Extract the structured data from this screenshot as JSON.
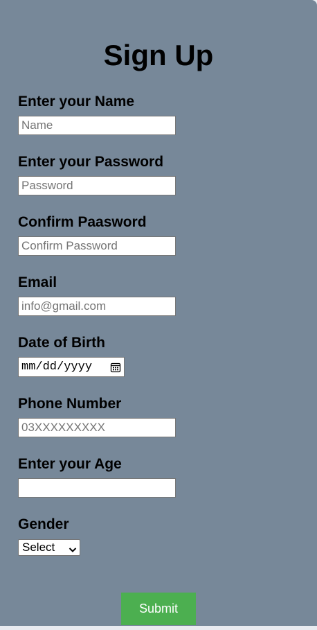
{
  "form": {
    "title": "Sign Up",
    "fields": {
      "name": {
        "label": "Enter your Name",
        "placeholder": "Name",
        "value": ""
      },
      "password": {
        "label": "Enter your Password",
        "placeholder": "Password",
        "value": ""
      },
      "confirm_password": {
        "label": "Confirm Paasword",
        "placeholder": "Confirm Password",
        "value": ""
      },
      "email": {
        "label": "Email",
        "placeholder": "info@gmail.com",
        "value": ""
      },
      "dob": {
        "label": "Date of Birth",
        "display": "mm/dd/yyyy",
        "icon": "calendar-icon"
      },
      "phone": {
        "label": "Phone Number",
        "placeholder": "03XXXXXXXXX",
        "value": ""
      },
      "age": {
        "label": "Enter your Age",
        "placeholder": "",
        "value": ""
      },
      "gender": {
        "label": "Gender",
        "selected": "Select",
        "icon": "chevron-down-icon"
      }
    },
    "submit_label": "Submit"
  },
  "colors": {
    "background": "#778899",
    "submit": "#4caf50",
    "submit_text": "#ffffff"
  }
}
